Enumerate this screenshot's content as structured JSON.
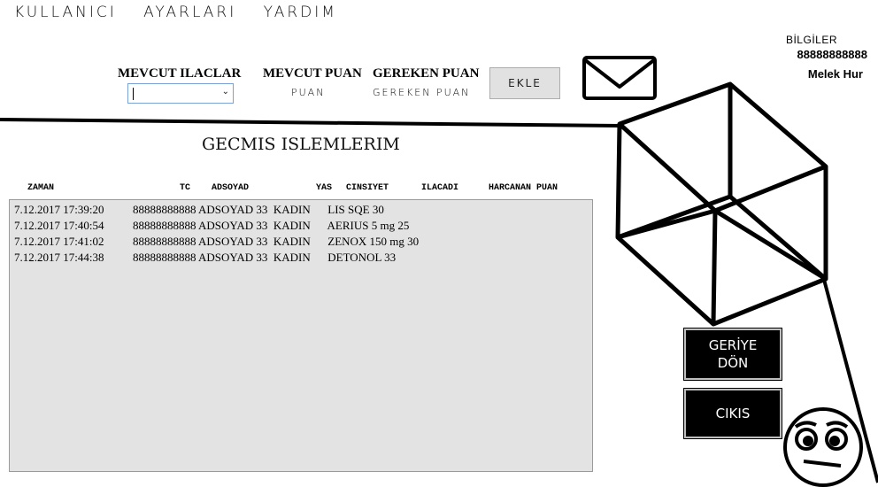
{
  "menu": {
    "items": [
      "KULLANICI",
      "AYARLARI",
      "YARDIM"
    ]
  },
  "info": {
    "label": "BİLGİLER",
    "tc": "88888888888",
    "name": "Melek Hur"
  },
  "form": {
    "mevcut_ilaclar_label": "MEVCUT ILACLAR",
    "mevcut_puan_label": "MEVCUT PUAN",
    "mevcut_puan_value": "PUAN",
    "gereken_puan_label": "GEREKEN PUAN",
    "gereken_puan_value": "GEREKEN PUAN",
    "ekle_label": "EKLE"
  },
  "history": {
    "title": "GECMIS ISLEMLERIM",
    "columns": [
      "ZAMAN",
      "TC",
      "ADSOYAD",
      "YAS",
      "CINSIYET",
      "ILACADI",
      "HARCANAN PUAN"
    ],
    "rows": [
      "7.12.2017 17:39:20          88888888888 ADSOYAD 33  KADIN      LIS SQE 30",
      "7.12.2017 17:40:54          88888888888 ADSOYAD 33  KADIN      AERIUS 5 mg 25",
      "7.12.2017 17:41:02          88888888888 ADSOYAD 33  KADIN      ZENOX 150 mg 30",
      "7.12.2017 17:44:38          88888888888 ADSOYAD 33  KADIN      DETONOL 33"
    ]
  },
  "buttons": {
    "geri_line1": "GERİYE",
    "geri_line2": "DÖN",
    "cikis": "CIKIS"
  },
  "icons": {
    "mail": "envelope-icon",
    "cube": "cube-drawing",
    "face": "face-icon"
  }
}
